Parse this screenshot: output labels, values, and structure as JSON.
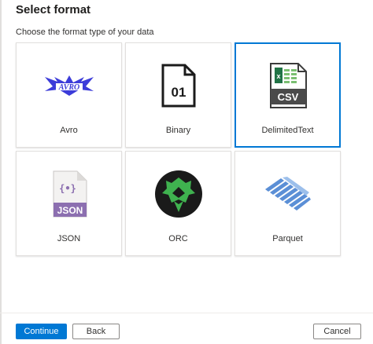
{
  "header": {
    "title": "Select format",
    "subtitle": "Choose the format type of your data"
  },
  "formats": [
    {
      "label": "Avro",
      "icon": "avro-logo-icon",
      "icon_text": "AVRO",
      "selected": false
    },
    {
      "label": "Binary",
      "icon": "binary-file-icon",
      "icon_text": "01",
      "selected": false
    },
    {
      "label": "DelimitedText",
      "icon": "csv-file-icon",
      "icon_text": "CSV",
      "selected": true
    },
    {
      "label": "JSON",
      "icon": "json-file-icon",
      "icon_text": "JSON",
      "icon_glyph": "{•}",
      "selected": false
    },
    {
      "label": "ORC",
      "icon": "orc-logo-icon",
      "selected": false
    },
    {
      "label": "Parquet",
      "icon": "parquet-logo-icon",
      "selected": false
    }
  ],
  "footer": {
    "continue_label": "Continue",
    "back_label": "Back",
    "cancel_label": "Cancel"
  },
  "colors": {
    "accent": "#0078d4",
    "avro": "#3c3cd9",
    "csv_green": "#217346",
    "json_purple": "#8c6fb0",
    "orc_green": "#3fb24f",
    "parquet_blue": "#5b8fd6"
  }
}
